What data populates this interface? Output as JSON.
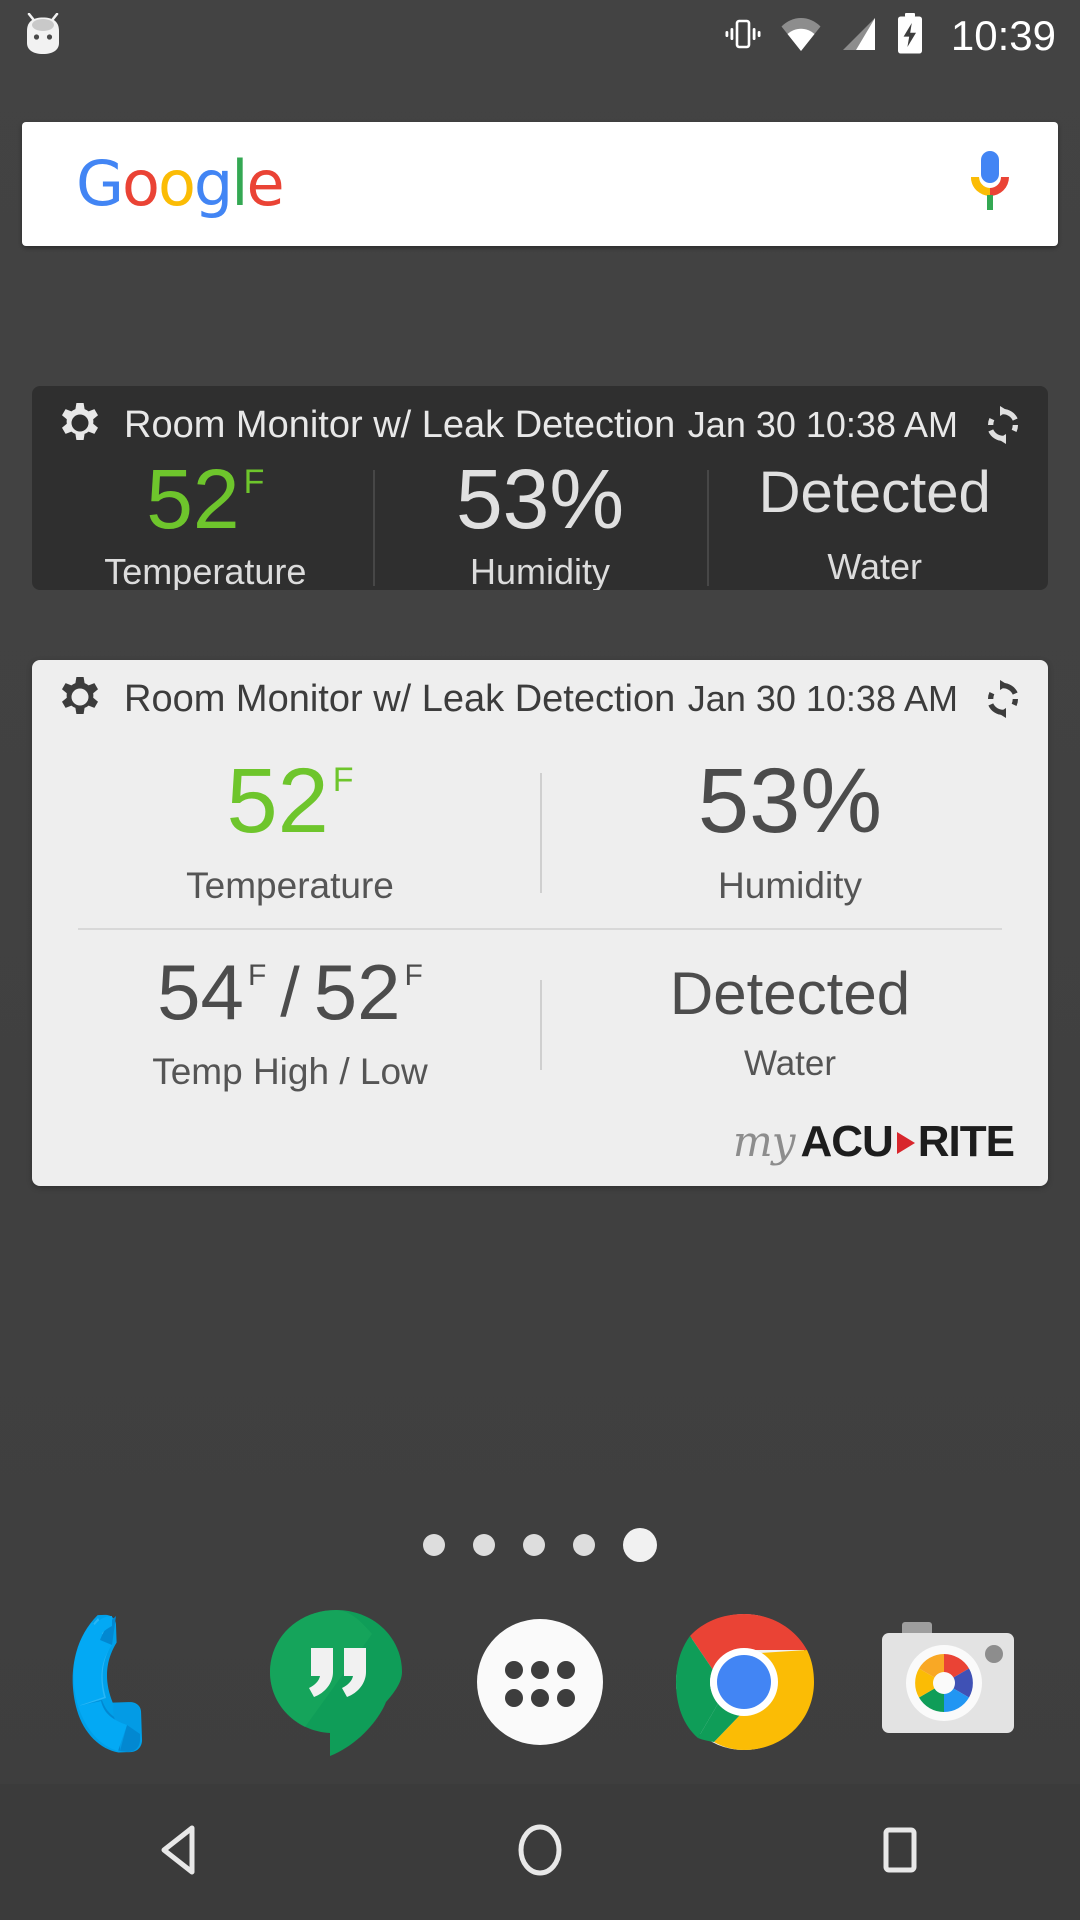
{
  "status_bar": {
    "clock": "10:39",
    "icons": [
      "android-head-icon",
      "vibrate-icon",
      "wifi-icon",
      "cell-signal-icon",
      "battery-charging-icon"
    ]
  },
  "search": {
    "logo_letters": [
      {
        "ch": "G",
        "color": "#4285F4"
      },
      {
        "ch": "o",
        "color": "#EA4335"
      },
      {
        "ch": "o",
        "color": "#FBBC05"
      },
      {
        "ch": "g",
        "color": "#4285F4"
      },
      {
        "ch": "l",
        "color": "#34A853"
      },
      {
        "ch": "e",
        "color": "#EA4335"
      }
    ],
    "mic_label": "voice-search"
  },
  "widget_dark": {
    "title": "Room Monitor w/ Leak Detection",
    "timestamp": "Jan 30 10:38 AM",
    "metrics": [
      {
        "value": "52",
        "unit": "F",
        "label": "Temperature",
        "color": "#6ec52c"
      },
      {
        "value": "53",
        "unit": "%",
        "label": "Humidity",
        "color": "#e0e0e0"
      },
      {
        "value": "Detected",
        "unit": "",
        "label": "Water",
        "color": "#e0e0e0"
      }
    ]
  },
  "widget_light": {
    "title": "Room Monitor w/ Leak Detection",
    "timestamp": "Jan 30 10:38 AM",
    "temperature": {
      "value": "52",
      "unit": "F",
      "label": "Temperature"
    },
    "humidity": {
      "value": "53",
      "unit": "%",
      "label": "Humidity"
    },
    "temp_high_low": {
      "high": "54",
      "high_unit": "F",
      "separator": "/",
      "low": "52",
      "low_unit": "F",
      "label": "Temp High / Low"
    },
    "water": {
      "value": "Detected",
      "label": "Water"
    },
    "brand": {
      "my": "my",
      "acu": "ACU",
      "rite": "RITE"
    }
  },
  "page_indicator": {
    "count": 5,
    "active_index": 4
  },
  "dock": {
    "items": [
      {
        "name": "phone",
        "label": "Phone"
      },
      {
        "name": "hangouts",
        "label": "Hangouts"
      },
      {
        "name": "app-drawer",
        "label": "Apps"
      },
      {
        "name": "chrome",
        "label": "Chrome"
      },
      {
        "name": "camera",
        "label": "Camera"
      }
    ]
  },
  "nav_bar": {
    "buttons": [
      {
        "name": "back",
        "label": "Back"
      },
      {
        "name": "home",
        "label": "Home"
      },
      {
        "name": "recents",
        "label": "Recents"
      }
    ]
  },
  "colors": {
    "accent_green": "#6ec52c",
    "widget_dark_bg": "#2f2f2f",
    "widget_light_bg": "#eeeeee",
    "wallpaper": "#414141",
    "brand_red": "#d8262c"
  }
}
